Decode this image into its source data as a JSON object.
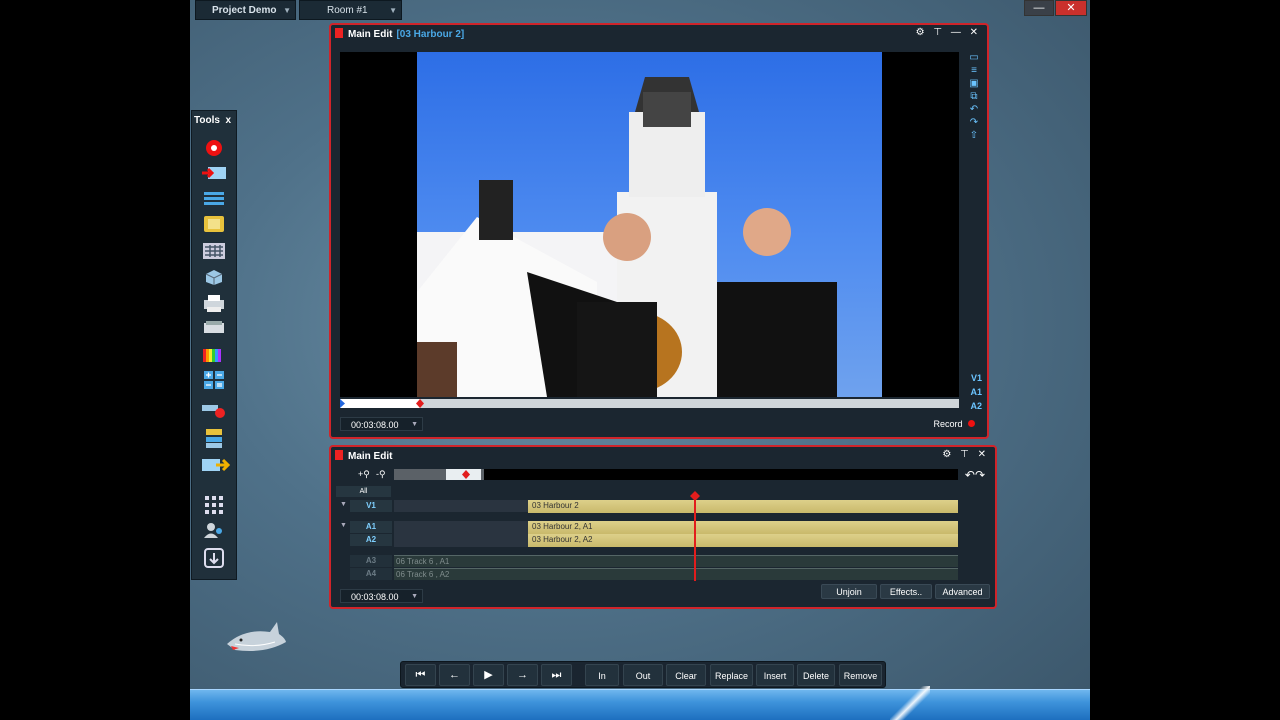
{
  "topbar": {
    "project": "Project Demo",
    "room": "Room #1",
    "minimize": "—",
    "close": "✕"
  },
  "tools": {
    "title": "Tools",
    "close": "x",
    "icons": [
      "record-icon",
      "input-icon",
      "list-icon",
      "folder-icon",
      "grid-icon",
      "box-icon",
      "printer-icon",
      "scanner-icon",
      "color-bars-icon",
      "calculator-icon",
      "effects-icon",
      "transfer-icon",
      "export-icon",
      "keypad-icon",
      "users-icon",
      "download-icon"
    ]
  },
  "viewer": {
    "title": "Main Edit",
    "clip": "[03 Harbour 2]",
    "controls": "⚙ ⊤ — ✕",
    "timecode": "00:03:08.00",
    "record_label": "Record",
    "tracks": [
      "V1",
      "A1",
      "A2"
    ]
  },
  "timeline": {
    "title": "Main Edit",
    "controls": "⚙ ⊤ ✕",
    "zoom_in": "+⚲",
    "zoom_out": "-⚲",
    "all_label": "All",
    "tracks": {
      "v1": "V1",
      "a1": "A1",
      "a2": "A2",
      "a3": "A3",
      "a4": "A4"
    },
    "clips": {
      "v1": "03 Harbour 2",
      "a1": "03 Harbour 2, A1",
      "a2": "03 Harbour 2, A2",
      "a3": "06 Track 6 , A1",
      "a4": "06 Track 6 , A2"
    },
    "timecode": "00:03:08.00",
    "buttons": {
      "unjoin": "Unjoin",
      "effects": "Effects..",
      "advanced": "Advanced"
    }
  },
  "transport": {
    "in": "In",
    "out": "Out",
    "clear": "Clear",
    "replace": "Replace",
    "insert": "Insert",
    "delete": "Delete",
    "remove": "Remove"
  },
  "colors": {
    "panel_border": "#d0242a",
    "accent_blue": "#4aa8e6",
    "clip_yellow": "#d4c47a",
    "playhead": "#e21d1d"
  }
}
